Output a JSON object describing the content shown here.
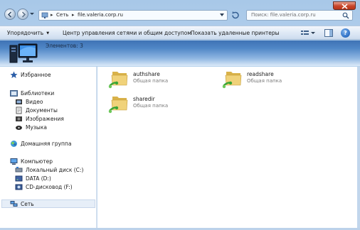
{
  "address": {
    "segments": [
      "Сеть",
      "file.valeria.corp.ru"
    ]
  },
  "search": {
    "placeholder": "Поиск: file.valeria.corp.ru"
  },
  "toolbar": {
    "organize_label": "Упорядочить",
    "network_center_label": "Центр управления сетями и общим доступом",
    "remote_printers_label": "Показать удаленные принтеры"
  },
  "header": {
    "item_count": "Элементов: 3"
  },
  "navpane": {
    "favorites": "Избранное",
    "libraries": "Библиотеки",
    "library_items": [
      "Видео",
      "Документы",
      "Изображения",
      "Музыка"
    ],
    "homegroup": "Домашняя группа",
    "computer": "Компьютер",
    "drives": [
      "Локальный диск (C:)",
      "DATA (D:)",
      "CD-дисковод (F:)"
    ],
    "network": "Сеть"
  },
  "content": {
    "items": [
      {
        "name": "authshare",
        "type": "Общая папка"
      },
      {
        "name": "readshare",
        "type": "Общая папка"
      },
      {
        "name": "sharedir",
        "type": "Общая папка"
      }
    ]
  },
  "icons": {
    "back": "arrow-left-icon",
    "forward": "arrow-right-icon",
    "search": "magnifier-icon",
    "favorites": "star-icon",
    "libraries": "library-icon",
    "homegroup": "homegroup-icon",
    "computer": "computer-icon",
    "network": "network-icon",
    "shared_folder": "shared-folder-icon",
    "help": "help-icon"
  },
  "colors": {
    "frame": "#b9d3ee",
    "toolbar": "#dde8f5",
    "header_band": "#4f86c6",
    "close_button": "#c7452a",
    "folder": "#e8c862",
    "share_badge": "#3aa535"
  }
}
